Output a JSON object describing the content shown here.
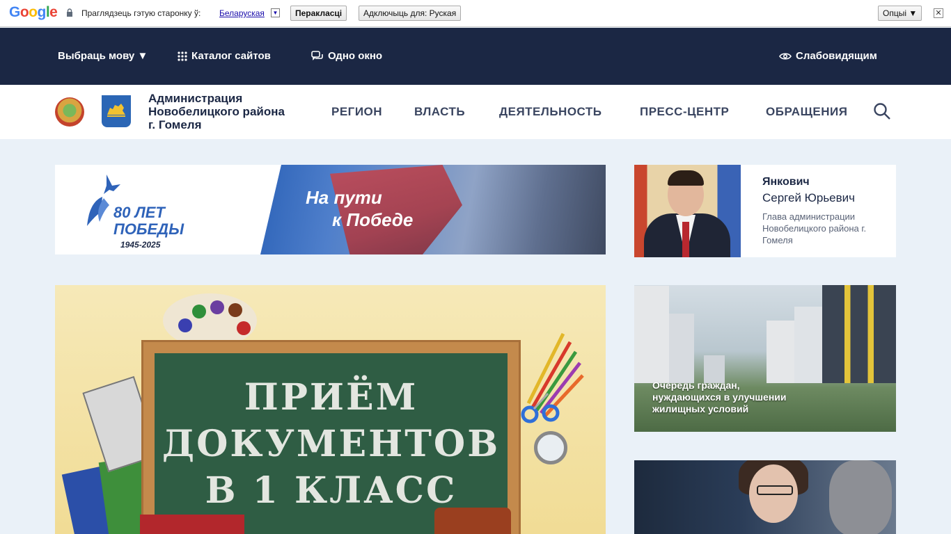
{
  "translate_bar": {
    "logo": "Google",
    "view_page_text": "Праглядзець гэтую старонку ў:",
    "language": "Беларуская",
    "translate_button": "Перакласці",
    "disable_button": "Адключыць для: Руская",
    "options_button": "Опцыі ▼",
    "close": "✕"
  },
  "topbar": {
    "select_language": "Выбраць мову ▼",
    "catalog": "Каталог сайтов",
    "one_window": "Одно окно",
    "visually_impaired": "Слабовидящим"
  },
  "header": {
    "site_title": "Администрация Новобелицкого района г. Гомеля",
    "nav": [
      "РЕГИОН",
      "ВЛАСТЬ",
      "ДЕЯТЕЛЬНОСТЬ",
      "ПРЕСС-ЦЕНТР",
      "ОБРАЩЕНИЯ"
    ]
  },
  "banner": {
    "years_label": "80 ЛЕТ ПОБЕДЫ",
    "years_range": "1945-2025",
    "slogan_line1": "На пути",
    "slogan_line2": "к Победе"
  },
  "person": {
    "surname": "Янкович",
    "name": "Сергей Юрьевич",
    "role": "Глава администрации Новобелицкого района г. Гомеля"
  },
  "main_news": {
    "board_line1": "ПРИЁМ",
    "board_line2": "ДОКУМЕНТОВ",
    "board_line3": "В 1 КЛАСС"
  },
  "side_news": {
    "housing_caption": "Очередь граждан, нуждающихся в улучшении жилищных условий"
  },
  "colors": {
    "topbar_bg": "#1b2744",
    "page_bg": "#eaf1f8",
    "nav_text": "#3a4560",
    "accent_blue": "#2f63b9"
  }
}
